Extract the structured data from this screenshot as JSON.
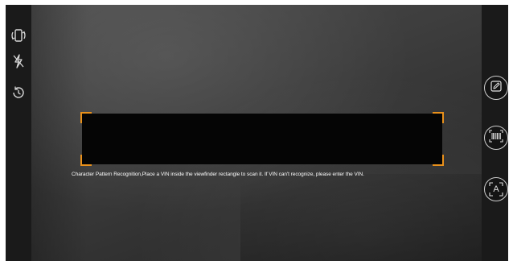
{
  "left_toolbar": {
    "icons": [
      "rotate-phone-icon",
      "flash-off-icon",
      "history-icon"
    ]
  },
  "scanner": {
    "hint": "Character Pattern Recognition,Place a VIN inside the viewfinder rectangle to scan it. If VIN can't recognize, please enter the VIN.",
    "corner_color": "#e8901b"
  },
  "right_toolbar": {
    "buttons": [
      {
        "name": "manual-input",
        "icon": "edit-icon"
      },
      {
        "name": "barcode-scan",
        "icon": "barcode-icon"
      },
      {
        "name": "text-recognition",
        "icon": "text-scan-icon",
        "label": "A"
      }
    ]
  }
}
